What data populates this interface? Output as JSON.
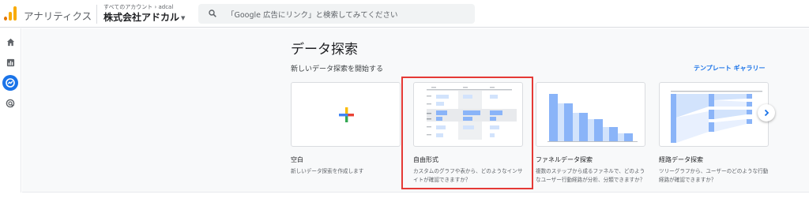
{
  "header": {
    "app_name": "アナリティクス",
    "account_crumb": "すべてのアカウント › adcal",
    "property_name": "株式会社アドカル",
    "search_placeholder": "「Google 広告にリンク」と検索してみてください"
  },
  "sidebar": {
    "items": [
      {
        "name": "home-icon"
      },
      {
        "name": "reports-icon"
      },
      {
        "name": "explore-icon",
        "active": true
      },
      {
        "name": "advertising-icon"
      }
    ]
  },
  "main": {
    "title": "データ探索",
    "section_label": "新しいデータ探索を開始する",
    "gallery_link": "テンプレート ギャラリー",
    "cards": [
      {
        "title": "空白",
        "description": "新しいデータ探索を作成します"
      },
      {
        "title": "自由形式",
        "description": "カスタムのグラフや表から、どのようなインサイトが確認できますか？"
      },
      {
        "title": "ファネルデータ探索",
        "description": "複数のステップから成るファネルで、どのようなユーザー行動経路が分析、分類できますか？"
      },
      {
        "title": "経路データ探索",
        "description": "ツリーグラフから、ユーザーのどのような行動経路が確認できますか？"
      }
    ],
    "highlighted_card": "自由形式"
  },
  "colors": {
    "accent": "#1a73e8",
    "highlight": "#e53935",
    "chart_blue": "#8ab4f8",
    "logo_orange": "#f9ab00",
    "logo_dark_orange": "#e37400"
  }
}
